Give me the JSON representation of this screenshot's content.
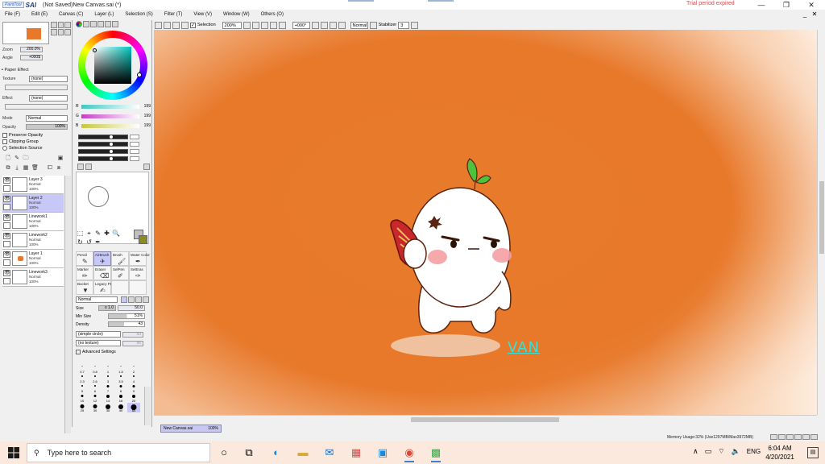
{
  "window": {
    "app_logo": "SAI",
    "app_logo_small": "PaintTool",
    "title": "(Not Saved)New Canvas.sai (*)",
    "trial_notice": "Trial period expired",
    "minimize": "—",
    "maximize": "❐",
    "close": "✕"
  },
  "menu": {
    "items": [
      "File (F)",
      "Edit (E)",
      "Canvas (C)",
      "Layer (L)",
      "Selection (S)",
      "Filter (T)",
      "View (V)",
      "Window (W)",
      "Others (O)"
    ]
  },
  "toolbar": {
    "selection_label": "Selection",
    "selection_checked": "✓",
    "zoom": "200%",
    "angle": "+000°",
    "blend": "Normal",
    "stabilizer_label": "Stabilizer",
    "stabilizer_value": "3"
  },
  "navigator": {
    "zoom_label": "Zoom",
    "zoom_value": "200.0%",
    "angle_label": "Angle",
    "angle_value": "+000$"
  },
  "paper_effect": {
    "header": "Paper Effect",
    "texture_label": "Texture",
    "texture_value": "(none)",
    "effect_label": "Effect",
    "effect_value": "(none)"
  },
  "layer_props": {
    "mode_label": "Mode",
    "mode_value": "Normal",
    "opacity_label": "Opacity",
    "opacity_value": "100%",
    "preserve_opacity": "Preserve Opacity",
    "clipping_group": "Clipping Group",
    "selection_source": "Selection Source"
  },
  "layers": [
    {
      "name": "Layer 3",
      "mode": "Normal",
      "opacity": "100%",
      "selected": false,
      "has_content": false,
      "eye": "👁"
    },
    {
      "name": "Layer 2",
      "mode": "Normal",
      "opacity": "100%",
      "selected": true,
      "has_content": false,
      "eye": "👁"
    },
    {
      "name": "Linework1",
      "mode": "Normal",
      "opacity": "100%",
      "selected": false,
      "has_content": false,
      "eye": "👁"
    },
    {
      "name": "Linework2",
      "mode": "Normal",
      "opacity": "100%",
      "selected": false,
      "has_content": false,
      "eye": "👁"
    },
    {
      "name": "Layer 1",
      "mode": "Normal",
      "opacity": "100%",
      "selected": false,
      "has_content": true,
      "eye": "👁"
    },
    {
      "name": "Linework3",
      "mode": "Normal",
      "opacity": "100%",
      "selected": false,
      "has_content": false,
      "eye": "👁"
    }
  ],
  "color": {
    "r_label": "R",
    "r_value": "199",
    "g_label": "G",
    "g_value": "199",
    "b_label": "B",
    "b_value": "199",
    "r_color": "#3fc7c0",
    "g_color": "#c43fc7",
    "b_color": "#c7c73f"
  },
  "tools": {
    "icons": [
      "⬚",
      "⌖",
      "✎",
      "✚",
      "🔍",
      "↻",
      "↺",
      "✒"
    ],
    "brushes": [
      {
        "name": "Pencil",
        "icon": "✎",
        "selected": false
      },
      {
        "name": "AirBrush",
        "icon": "✈",
        "selected": true
      },
      {
        "name": "Brush",
        "icon": "🖌",
        "selected": false
      },
      {
        "name": "Water Color",
        "icon": "✒",
        "selected": false
      },
      {
        "name": "Marker",
        "icon": "✏",
        "selected": false
      },
      {
        "name": "Eraser",
        "icon": "⌫",
        "selected": false
      },
      {
        "name": "SelPen",
        "icon": "✐",
        "selected": false
      },
      {
        "name": "SelEras",
        "icon": "✑",
        "selected": false
      },
      {
        "name": "Bucket",
        "icon": "▼",
        "selected": false
      },
      {
        "name": "Legacy Pen",
        "icon": "✍",
        "selected": false
      }
    ]
  },
  "brush_settings": {
    "blend_mode": "Normal",
    "size_label": "Size",
    "size_mult": "x 1.0",
    "size_value": "50.0",
    "min_size_label": "Min Size",
    "min_size_value": "51%",
    "density_label": "Density",
    "density_value": "43",
    "shape": "(simple circle)",
    "shape_value": "50",
    "texture": "(no texture)",
    "texture_value": "95",
    "advanced": "Advanced Settings"
  },
  "brush_sizes": [
    "0.7",
    "0.8",
    "1",
    "1.5",
    "2",
    "2.3",
    "2.6",
    "3",
    "3.5",
    "4",
    "5",
    "6",
    "7",
    "8",
    "9",
    "10",
    "12",
    "14",
    "16",
    "20",
    "25",
    "30",
    "35",
    "40",
    "50"
  ],
  "canvas": {
    "signature": "VAN",
    "background_color": "#e8792b"
  },
  "doc_tab": {
    "name": "New Canvas.sai",
    "zoom": "100%"
  },
  "status": {
    "memory": "Memory Usage:32% (Use1297MB/Max3972MB)"
  },
  "taskbar": {
    "search_placeholder": "Type here to search",
    "language": "ENG",
    "time": "6:04 AM",
    "date": "4/20/2021"
  }
}
